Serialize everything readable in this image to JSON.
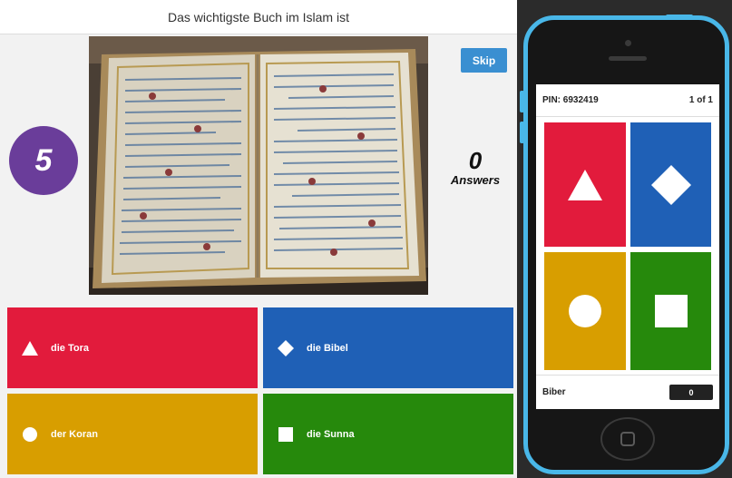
{
  "question": {
    "text": "Das wichtigste Buch im Islam ist"
  },
  "controls": {
    "skip_label": "Skip"
  },
  "timer": {
    "value": "5"
  },
  "answers_counter": {
    "count": "0",
    "label": "Answers"
  },
  "answers": [
    {
      "label": "die Tora",
      "shape": "triangle-icon",
      "color": "#e21b3c"
    },
    {
      "label": "die Bibel",
      "shape": "diamond-icon",
      "color": "#1f60b6"
    },
    {
      "label": "der Koran",
      "shape": "circle-icon",
      "color": "#d89e00"
    },
    {
      "label": "die Sunna",
      "shape": "square-icon",
      "color": "#26890c"
    }
  ],
  "phone": {
    "pin": "PIN: 6932419",
    "progress": "1 of 1",
    "nickname": "Biber",
    "score": "0",
    "frame_color": "#49b7e8"
  }
}
